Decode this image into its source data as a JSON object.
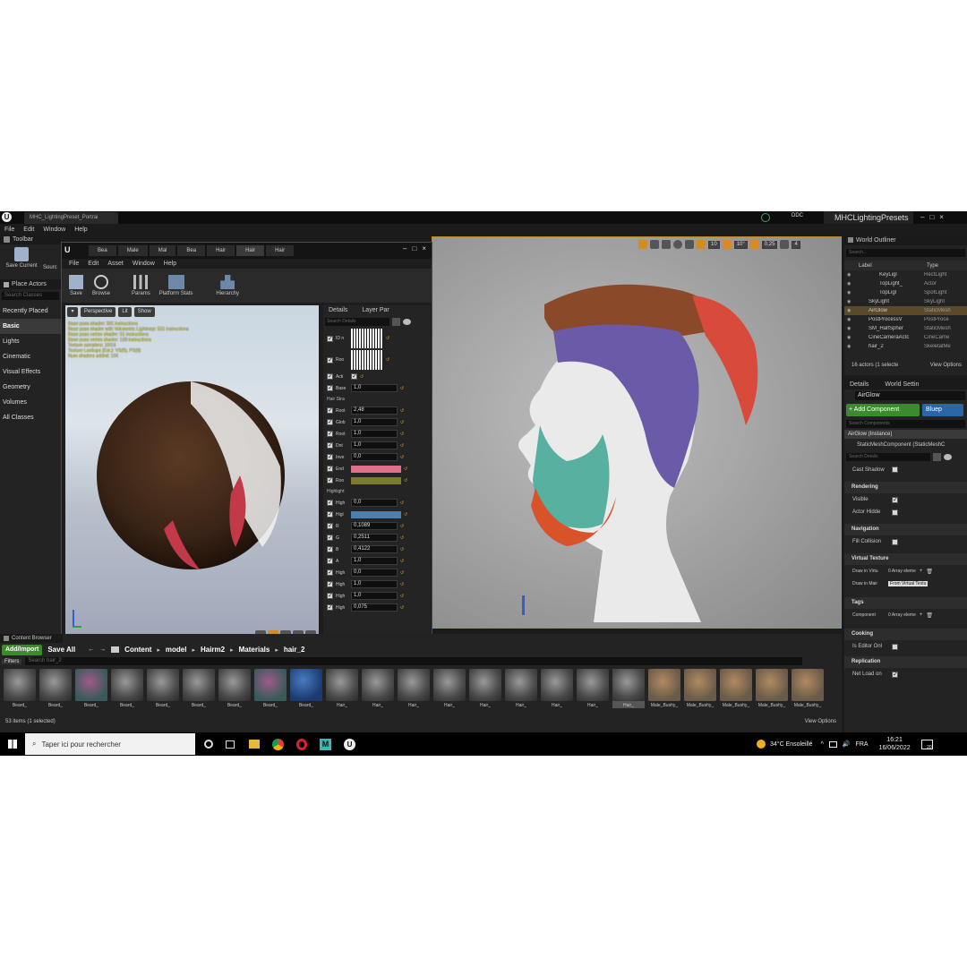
{
  "app": {
    "project_tab": "MHC_LightingPreset_Portrai",
    "project_name": "MHCLightingPresets",
    "ddc": "DDC",
    "menu": [
      "File",
      "Edit",
      "Window",
      "Help"
    ]
  },
  "left_panel": {
    "toolbar_label": "Toolbar",
    "save_current": "Save Current",
    "source": "Sourc",
    "place_actors": "Place Actors",
    "search_placeholder": "Search Classes",
    "categories": [
      "Recently Placed",
      "Basic",
      "Lights",
      "Cinematic",
      "Visual Effects",
      "Geometry",
      "Volumes",
      "All Classes"
    ],
    "selected": "Basic"
  },
  "material_editor": {
    "tabs": [
      "Bea",
      "Male",
      "Mal",
      "Bea",
      "Hair",
      "Hair",
      "Hair"
    ],
    "menu": [
      "File",
      "Edit",
      "Asset",
      "Window",
      "Help"
    ],
    "toolbar": [
      "Save",
      "Browse",
      "Params",
      "Platform Stats",
      "Hierarchy"
    ],
    "viewport_buttons": [
      "Perspective",
      "Lit",
      "Show"
    ],
    "stats": [
      "Base pass shader: 391 instructions",
      "Base pass shader with Volumetric Lightmap: 531 instructions",
      "Base pass vertex shader: 51 instructions",
      "Base pass vertex shader: 109 instructions",
      "Texture samplers: 10/16",
      "Texture Lookups (Est.): VS(0), PS(8)",
      "Num shaders added: 104"
    ],
    "details_tab": "Details",
    "layer_tab": "Layer Par",
    "search_details": "Search Details",
    "hair_strand_section": "Hair Stra",
    "highlight_section": "Highlight",
    "params_top": [
      {
        "label": "ID n",
        "type": "texture"
      },
      {
        "label": "Roo",
        "type": "texture"
      },
      {
        "label": "Acti",
        "type": "check"
      },
      {
        "label": "Base",
        "value": "1,0"
      }
    ],
    "params_hair": [
      {
        "label": "Root",
        "value": "2,48"
      },
      {
        "label": "Glob",
        "value": "1,0"
      },
      {
        "label": "Root",
        "value": "1,0"
      },
      {
        "label": "Dnt",
        "value": "1,0"
      },
      {
        "label": "Inve",
        "value": "0,0"
      },
      {
        "label": "End",
        "color": "#e07088"
      },
      {
        "label": "Roo",
        "color": "#7a7a30"
      }
    ],
    "params_highlight": [
      {
        "label": "High",
        "value": "0,0"
      },
      {
        "label": "Higl",
        "color": "#4d7fae"
      },
      {
        "label": "R",
        "value": "0,1089"
      },
      {
        "label": "G",
        "value": "0,2511"
      },
      {
        "label": "B",
        "value": "0,4122"
      },
      {
        "label": "A",
        "value": "1,0"
      },
      {
        "label": "High",
        "value": "0,0"
      },
      {
        "label": "High",
        "value": "1,0"
      },
      {
        "label": "High",
        "value": "1,0"
      },
      {
        "label": "High",
        "value": "0,075"
      }
    ]
  },
  "viewport": {
    "snap_values": [
      "10",
      "10°",
      "0,25",
      "4"
    ]
  },
  "world_outliner": {
    "title": "World Outliner",
    "search_placeholder": "Search...",
    "col_label": "Label",
    "col_type": "Type",
    "rows": [
      {
        "label": "KeyLigl",
        "type": "RectLight"
      },
      {
        "label": "TopLight_",
        "type": "Actor"
      },
      {
        "label": "TopLigl",
        "type": "SpotLight"
      },
      {
        "label": "SkyLight",
        "type": "SkyLight"
      },
      {
        "label": "AirGlow",
        "type": "StaticMesh"
      },
      {
        "label": "PostProcessV",
        "type": "PostProce"
      },
      {
        "label": "SM_HalfSpher",
        "type": "StaticMesh"
      },
      {
        "label": "CineCameraActc",
        "type": "CineCame"
      },
      {
        "label": "hair_2",
        "type": "SkeletalMe"
      }
    ],
    "selected_row": "AirGlow",
    "footer": "16 actors (1 selecte",
    "view_options": "View Options"
  },
  "details": {
    "tab": "Details",
    "world_settings_tab": "World Settin",
    "actor_name": "AirGlow",
    "add_component": "+ Add Component",
    "blueprint": "Bluep",
    "search_components": "Search Components",
    "instance": "AirGlow (Instance)",
    "component": "StaticMeshComponent (StaticMeshC",
    "search_details": "Search Details",
    "cast_shadow": "Cast Shadow",
    "sections": {
      "rendering": "Rendering",
      "navigation": "Navigation",
      "virtual_texture": "Virtual Texture",
      "tags": "Tags",
      "cooking": "Cooking",
      "replication": "Replication"
    },
    "visible": "Visible",
    "actor_hidden": "Actor Hidde",
    "fill_collision": "Fill Collision",
    "draw_in_virt": "Draw in Virtu",
    "draw_in_virt_val": "0 Array eleme",
    "draw_in_main": "Draw in Mair",
    "draw_in_main_val": "From Virtual Textu",
    "component_tags": "Component",
    "component_tags_val": "0 Array eleme",
    "is_editor_only": "Is Editor Onl",
    "net_load_on": "Net Load on"
  },
  "content_browser": {
    "title": "Content Browser",
    "add_import": "Add/Import",
    "save_all": "Save All",
    "breadcrumbs": [
      "Content",
      "model",
      "Hairm2",
      "Materials",
      "hair_2"
    ],
    "filters": "Filters",
    "search_placeholder": "Search hair_2",
    "assets": [
      "Beard_",
      "Beard_",
      "Beard_",
      "Beard_",
      "Beard_",
      "Beard_",
      "Beard_",
      "Beard_",
      "Beard_",
      "Hair_",
      "Hair_",
      "Hair_",
      "Hair_",
      "Hair_",
      "Hair_",
      "Hair_",
      "Hair_",
      "Hair_",
      "Male_Bushy_",
      "Male_Bushy_",
      "Male_Bushy_",
      "Male_Bushy_",
      "Male_Bushy_"
    ],
    "selected_index": 17,
    "status": "53 items (1 selected)",
    "view_options": "View Options"
  },
  "taskbar": {
    "search_placeholder": "Taper ici pour rechercher",
    "weather": "34°C  Ensoleillé",
    "lang": "FRA",
    "time": "16:21",
    "date": "16/06/2022",
    "notif": "20"
  }
}
